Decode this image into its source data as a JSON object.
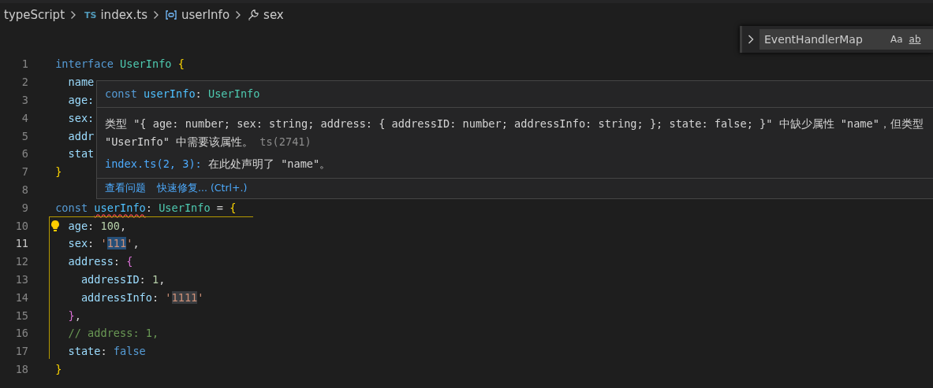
{
  "breadcrumb": [
    {
      "kind": "folder",
      "label": "typeScript"
    },
    {
      "kind": "file",
      "badge": "TS",
      "label": "index.ts"
    },
    {
      "kind": "variable",
      "label": "userInfo"
    },
    {
      "kind": "property",
      "label": "sex"
    }
  ],
  "find_widget": {
    "value": "EventHandlerMap",
    "options": [
      {
        "label": "Aa",
        "kind": "case"
      },
      {
        "label": "ab",
        "kind": "word"
      }
    ]
  },
  "lines": [
    {
      "n": "1",
      "current": false,
      "tokens": [
        {
          "kind": "kw",
          "t": "interface "
        },
        {
          "kind": "type",
          "t": "UserInfo "
        },
        {
          "kind": "b1",
          "t": "{"
        }
      ]
    },
    {
      "n": "2",
      "current": false,
      "tokens": [
        {
          "kind": "prop",
          "t": "  name"
        }
      ]
    },
    {
      "n": "3",
      "current": false,
      "tokens": [
        {
          "kind": "prop",
          "t": "  age:"
        }
      ]
    },
    {
      "n": "4",
      "current": false,
      "tokens": [
        {
          "kind": "prop",
          "t": "  sex:"
        }
      ]
    },
    {
      "n": "5",
      "current": false,
      "tokens": [
        {
          "kind": "prop",
          "t": "  addr"
        }
      ]
    },
    {
      "n": "6",
      "current": false,
      "tokens": [
        {
          "kind": "prop",
          "t": "  stat"
        }
      ]
    },
    {
      "n": "7",
      "current": false,
      "tokens": [
        {
          "kind": "b1",
          "t": "}"
        }
      ]
    },
    {
      "n": "8",
      "current": false
    },
    {
      "n": "9",
      "current": false,
      "tokens": [
        {
          "kind": "kw",
          "t": "const "
        },
        {
          "kind": "var",
          "t": "userInfo",
          "error": true
        },
        {
          "kind": "punct",
          "t": ": "
        },
        {
          "kind": "type",
          "t": "UserInfo "
        },
        {
          "kind": "punct",
          "t": "= "
        },
        {
          "kind": "b1",
          "t": "{"
        }
      ]
    },
    {
      "n": "10",
      "current": false,
      "lightbulb": true,
      "tokens": [
        {
          "kind": "prop",
          "t": "  age"
        },
        {
          "kind": "punct",
          "t": ": "
        },
        {
          "kind": "num",
          "t": "100"
        },
        {
          "kind": "punct",
          "t": ","
        }
      ]
    },
    {
      "n": "11",
      "current": true,
      "tokens": [
        {
          "kind": "prop",
          "t": "  sex"
        },
        {
          "kind": "punct",
          "t": ": "
        },
        {
          "kind": "str",
          "t": "'"
        },
        {
          "kind": "str",
          "t": "111",
          "selected": true
        },
        {
          "kind": "str",
          "t": "'"
        },
        {
          "kind": "punct",
          "t": ","
        }
      ]
    },
    {
      "n": "12",
      "current": false,
      "tokens": [
        {
          "kind": "prop",
          "t": "  address"
        },
        {
          "kind": "punct",
          "t": ": "
        },
        {
          "kind": "b2",
          "t": "{"
        }
      ]
    },
    {
      "n": "13",
      "current": false,
      "tokens": [
        {
          "kind": "prop",
          "t": "    addressID"
        },
        {
          "kind": "punct",
          "t": ": "
        },
        {
          "kind": "num",
          "t": "1"
        },
        {
          "kind": "punct",
          "t": ","
        }
      ]
    },
    {
      "n": "14",
      "current": false,
      "tokens": [
        {
          "kind": "prop",
          "t": "    addressInfo"
        },
        {
          "kind": "punct",
          "t": ": "
        },
        {
          "kind": "str",
          "t": "'"
        },
        {
          "kind": "str",
          "t": "1111",
          "highlighted": true
        },
        {
          "kind": "str",
          "t": "'"
        }
      ]
    },
    {
      "n": "15",
      "current": false,
      "tokens": [
        {
          "kind": "b2",
          "t": "  }"
        },
        {
          "kind": "punct",
          "t": ","
        }
      ]
    },
    {
      "n": "16",
      "current": false,
      "tokens": [
        {
          "kind": "comment",
          "t": "  // address: 1,"
        }
      ]
    },
    {
      "n": "17",
      "current": false,
      "tokens": [
        {
          "kind": "prop",
          "t": "  state"
        },
        {
          "kind": "punct",
          "t": ": "
        },
        {
          "kind": "kw",
          "t": "false"
        }
      ]
    },
    {
      "n": "18",
      "current": false,
      "tokens": [
        {
          "kind": "b1",
          "t": "}"
        }
      ]
    }
  ],
  "hover": {
    "signature": [
      {
        "kind": "kw",
        "t": "const "
      },
      {
        "kind": "var",
        "t": "userInfo"
      },
      {
        "kind": "punct",
        "t": ": "
      },
      {
        "kind": "type",
        "t": "UserInfo"
      }
    ],
    "message": "类型 \"{ age: number; sex: string; address: { addressID: number; addressInfo: string; }; state: false; }\" 中缺少属性 \"name\"，但类型 \"UserInfo\" 中需要该属性。",
    "code": "ts(2741)",
    "related_link": "index.ts(2, 3):",
    "related_text": "在此处声明了 \"name\"。",
    "actions": [
      {
        "label": "查看问题"
      },
      {
        "label": "快速修复... (Ctrl+.)"
      }
    ]
  }
}
